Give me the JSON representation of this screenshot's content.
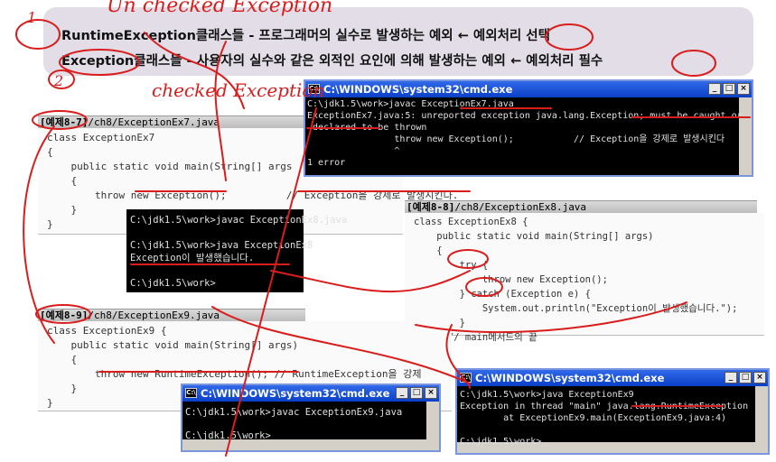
{
  "annotations": {
    "unchecked": "Un checked Exception",
    "checked": "checked Exception",
    "num1": "1",
    "num2": "2"
  },
  "summary": {
    "line1": {
      "term": "RuntimeException클래스들",
      "desc": " - 프로그래머의 실수로 발생하는 예외 ← 예외처리 ",
      "choice": "선택"
    },
    "line2": {
      "term": "Exception클래스들",
      "desc": " - 사용자의 실수와 같은 외적인 요인에 의해 발생하는 예외 ← 예외처리 ",
      "choice": "필수"
    }
  },
  "ex7": {
    "label": "[예제8-7]",
    "path": "/ch8/ExceptionEx7.java",
    "lines": [
      "class ExceptionEx7",
      "{",
      "    public static void main(String[] args",
      "    {",
      "        throw new Exception();          // Exception을 강제로 발생시킨다.",
      "    }",
      "}"
    ]
  },
  "cmd7": {
    "title": "C:\\WINDOWS\\system32\\cmd.exe",
    "lines": [
      "C:\\jdk1.5\\work>javac ExceptionEx7.java",
      "ExceptionEx7.java:5: unreported exception java.lang.Exception; must be caught or",
      " declared to be thrown",
      "                throw new Exception();           // Exception을 강제로 발생시킨다",
      "                ^",
      "1 error"
    ]
  },
  "console8": {
    "lines": [
      "C:\\jdk1.5\\work>javac ExceptionEx8.java",
      "",
      "C:\\jdk1.5\\work>java ExceptionEx8",
      "Exception이 발생했습니다.",
      "",
      "C:\\jdk1.5\\work>"
    ]
  },
  "ex8": {
    "label": "[예제8-8]",
    "path": "/ch8/ExceptionEx8.java",
    "lines": [
      "class ExceptionEx8 {",
      "    public static void main(String[] args)",
      "    {",
      "        try {",
      "            throw new Exception();",
      "        } catch (Exception e) {",
      "            System.out.println(\"Exception이 발생했습니다.\");",
      "        }",
      "    } // main메서드의 끝"
    ]
  },
  "ex9": {
    "label": "[예제8-9]",
    "path": "/ch8/ExceptionEx9.java",
    "lines": [
      "class ExceptionEx9 {",
      "    public static void main(String[] args)",
      "    {",
      "        throw new RuntimeException(); // RuntimeException을 강제",
      "    }",
      "}"
    ]
  },
  "cmd9a": {
    "title": "C:\\WINDOWS\\system32\\cmd.exe",
    "lines": [
      "C:\\jdk1.5\\work>javac ExceptionEx9.java",
      "",
      "C:\\jdk1.5\\work>"
    ]
  },
  "cmd9b": {
    "title": "C:\\WINDOWS\\system32\\cmd.exe",
    "lines": [
      "C:\\jdk1.5\\work>java ExceptionEx9",
      "Exception in thread \"main\" java.lang.RuntimeException",
      "        at ExceptionEx9.main(ExceptionEx9.java:4)",
      "",
      "C:\\jdk1.5\\work>_"
    ]
  },
  "window_buttons": {
    "minimize": "_",
    "maximize": "□",
    "close": "×"
  },
  "colors": {
    "annotation": "#d91d1d",
    "titlebar": "#0a3fc8",
    "summary_bg": "#e2dde6"
  }
}
